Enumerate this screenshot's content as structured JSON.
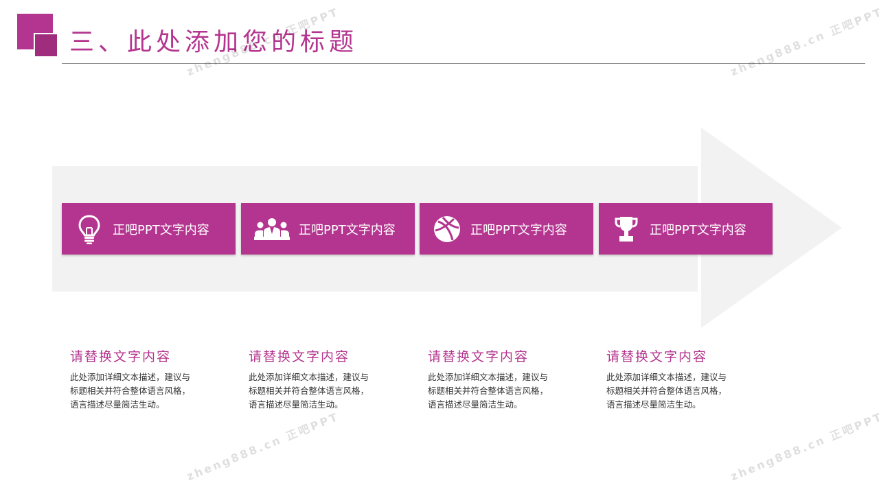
{
  "header": {
    "title": "三、此处添加您的标题"
  },
  "steps": [
    {
      "icon": "lightbulb-icon",
      "label": "正吧PPT文字内容",
      "heading": "请替换文字内容",
      "description": "此处添加详细文本描述，建议与标题相关并符合整体语言风格，语言描述尽量简洁生动。"
    },
    {
      "icon": "team-icon",
      "label": "正吧PPT文字内容",
      "heading": "请替换文字内容",
      "description": "此处添加详细文本描述，建议与标题相关并符合整体语言风格，语言描述尽量简洁生动。"
    },
    {
      "icon": "dribbble-ball-icon",
      "label": "正吧PPT文字内容",
      "heading": "请替换文字内容",
      "description": "此处添加详细文本描述，建议与标题相关并符合整体语言风格，语言描述尽量简洁生动。"
    },
    {
      "icon": "trophy-icon",
      "label": "正吧PPT文字内容",
      "heading": "请替换文字内容",
      "description": "此处添加详细文本描述，建议与标题相关并符合整体语言风格，语言描述尽量简洁生动。"
    }
  ],
  "watermark": {
    "text": "zheng888.cn 正吧PPT"
  },
  "colors": {
    "accent": "#B4358F",
    "band": "#f2f2f2",
    "text": "#333333"
  }
}
